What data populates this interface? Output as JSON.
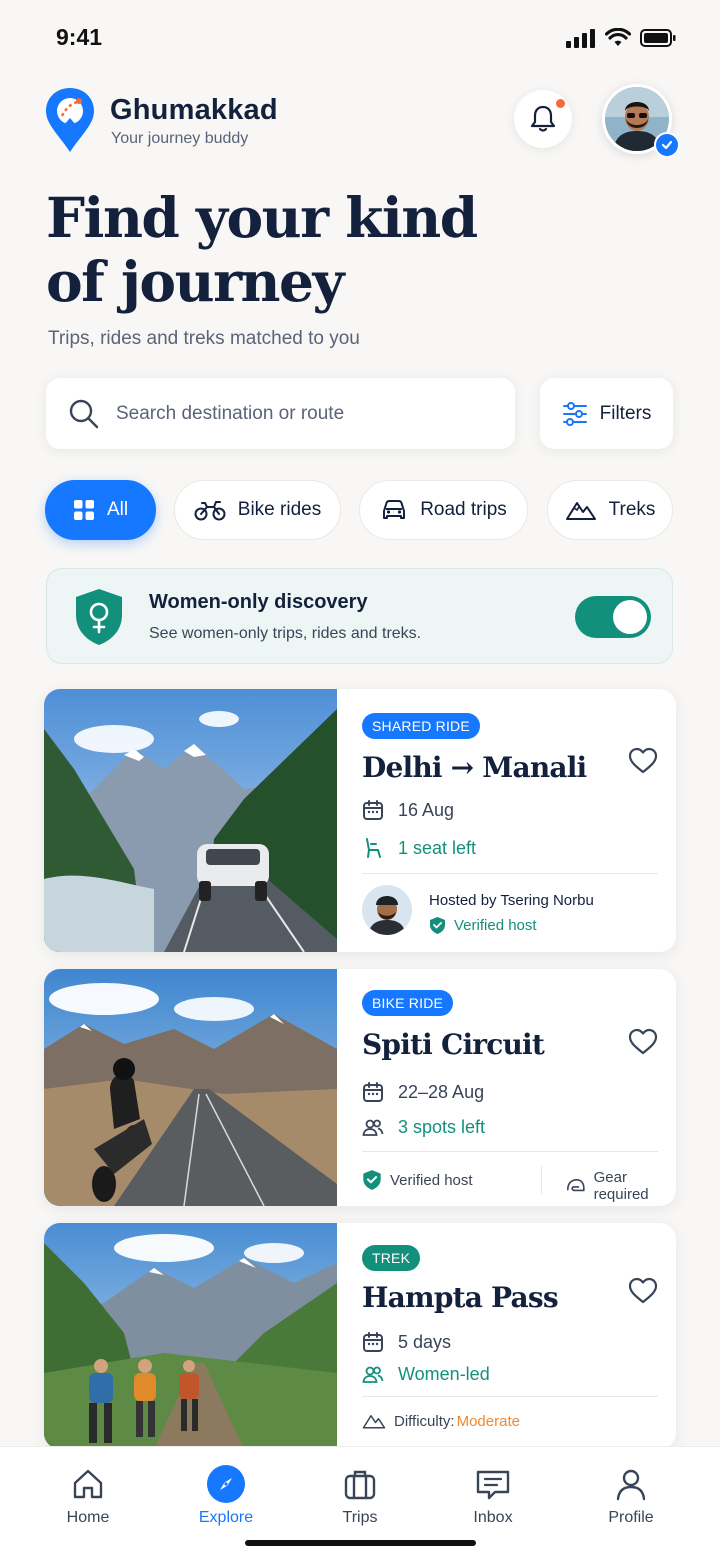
{
  "status_bar": {
    "time": "9:41"
  },
  "brand": {
    "name": "Ghumakkad",
    "tagline": "Your journey buddy"
  },
  "hero": {
    "title_line1": "Find your kind",
    "title_line2": "of journey",
    "subtitle": "Trips, rides and treks matched to you"
  },
  "search": {
    "placeholder": "Search destination or route",
    "value": ""
  },
  "filters": {
    "label": "Filters"
  },
  "categories": [
    {
      "label": "All",
      "icon": "grid-icon",
      "active": true
    },
    {
      "label": "Bike rides",
      "icon": "motorbike-icon",
      "active": false
    },
    {
      "label": "Road trips",
      "icon": "car-icon",
      "active": false
    },
    {
      "label": "Treks",
      "icon": "mountain-icon",
      "active": false
    }
  ],
  "women_only": {
    "title": "Women-only discovery",
    "subtitle": "See women-only trips, rides and treks.",
    "enabled": true
  },
  "listings": [
    {
      "badge": "SHARED RIDE",
      "title": "Delhi → Manali",
      "date": "16 Aug",
      "availability": "1 seat left",
      "host_line": "Hosted by Tsering Norbu",
      "host_verified": "Verified host"
    },
    {
      "badge": "BIKE RIDE",
      "title": "Spiti Circuit",
      "date": "22–28 Aug",
      "availability": "3 spots left",
      "verified": "Verified host",
      "gear": "Gear required"
    },
    {
      "badge": "TREK",
      "title": "Hampta Pass",
      "duration": "5 days",
      "leadership": "Women-led",
      "difficulty_label": "Difficulty:",
      "difficulty_value": "Moderate"
    }
  ],
  "tabbar": [
    {
      "label": "Home",
      "icon": "home-icon",
      "active": false
    },
    {
      "label": "Explore",
      "icon": "compass-icon",
      "active": true
    },
    {
      "label": "Trips",
      "icon": "suitcase-icon",
      "active": false
    },
    {
      "label": "Inbox",
      "icon": "chat-icon",
      "active": false
    },
    {
      "label": "Profile",
      "icon": "person-icon",
      "active": false
    }
  ],
  "colors": {
    "accent": "#1677ff",
    "teal": "#12907c",
    "navy": "#14213d",
    "orange": "#f2892e",
    "notification": "#f26a3d"
  }
}
